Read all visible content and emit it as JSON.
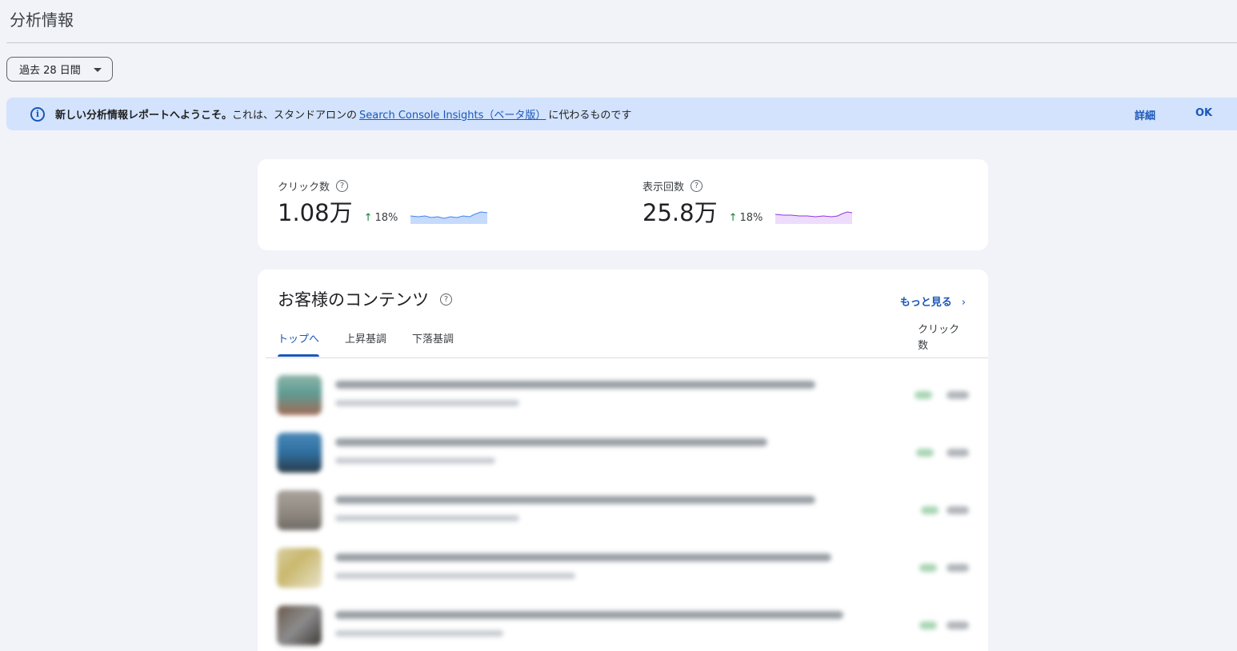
{
  "page": {
    "title": "分析情報"
  },
  "date_filter": {
    "label": "過去 28 日間"
  },
  "banner": {
    "strong_text": "新しい分析情報レポートへようこそ。",
    "text": "これは、スタンドアロンの",
    "link": "Search Console Insights（ベータ版）",
    "text_after": "に代わるものです",
    "details_label": "詳細",
    "ok_label": "OK"
  },
  "metrics": [
    {
      "label": "クリック数",
      "value": "1.08万",
      "change": "18%",
      "spark_color": "#4285f4"
    },
    {
      "label": "表示回数",
      "value": "25.8万",
      "change": "18%",
      "spark_color": "#9334e6"
    }
  ],
  "content": {
    "title": "お客様のコンテンツ",
    "see_more": "もっと見る",
    "tabs": [
      "トップへ",
      "上昇基調",
      "下落基調"
    ],
    "column_header": "クリック数"
  }
}
